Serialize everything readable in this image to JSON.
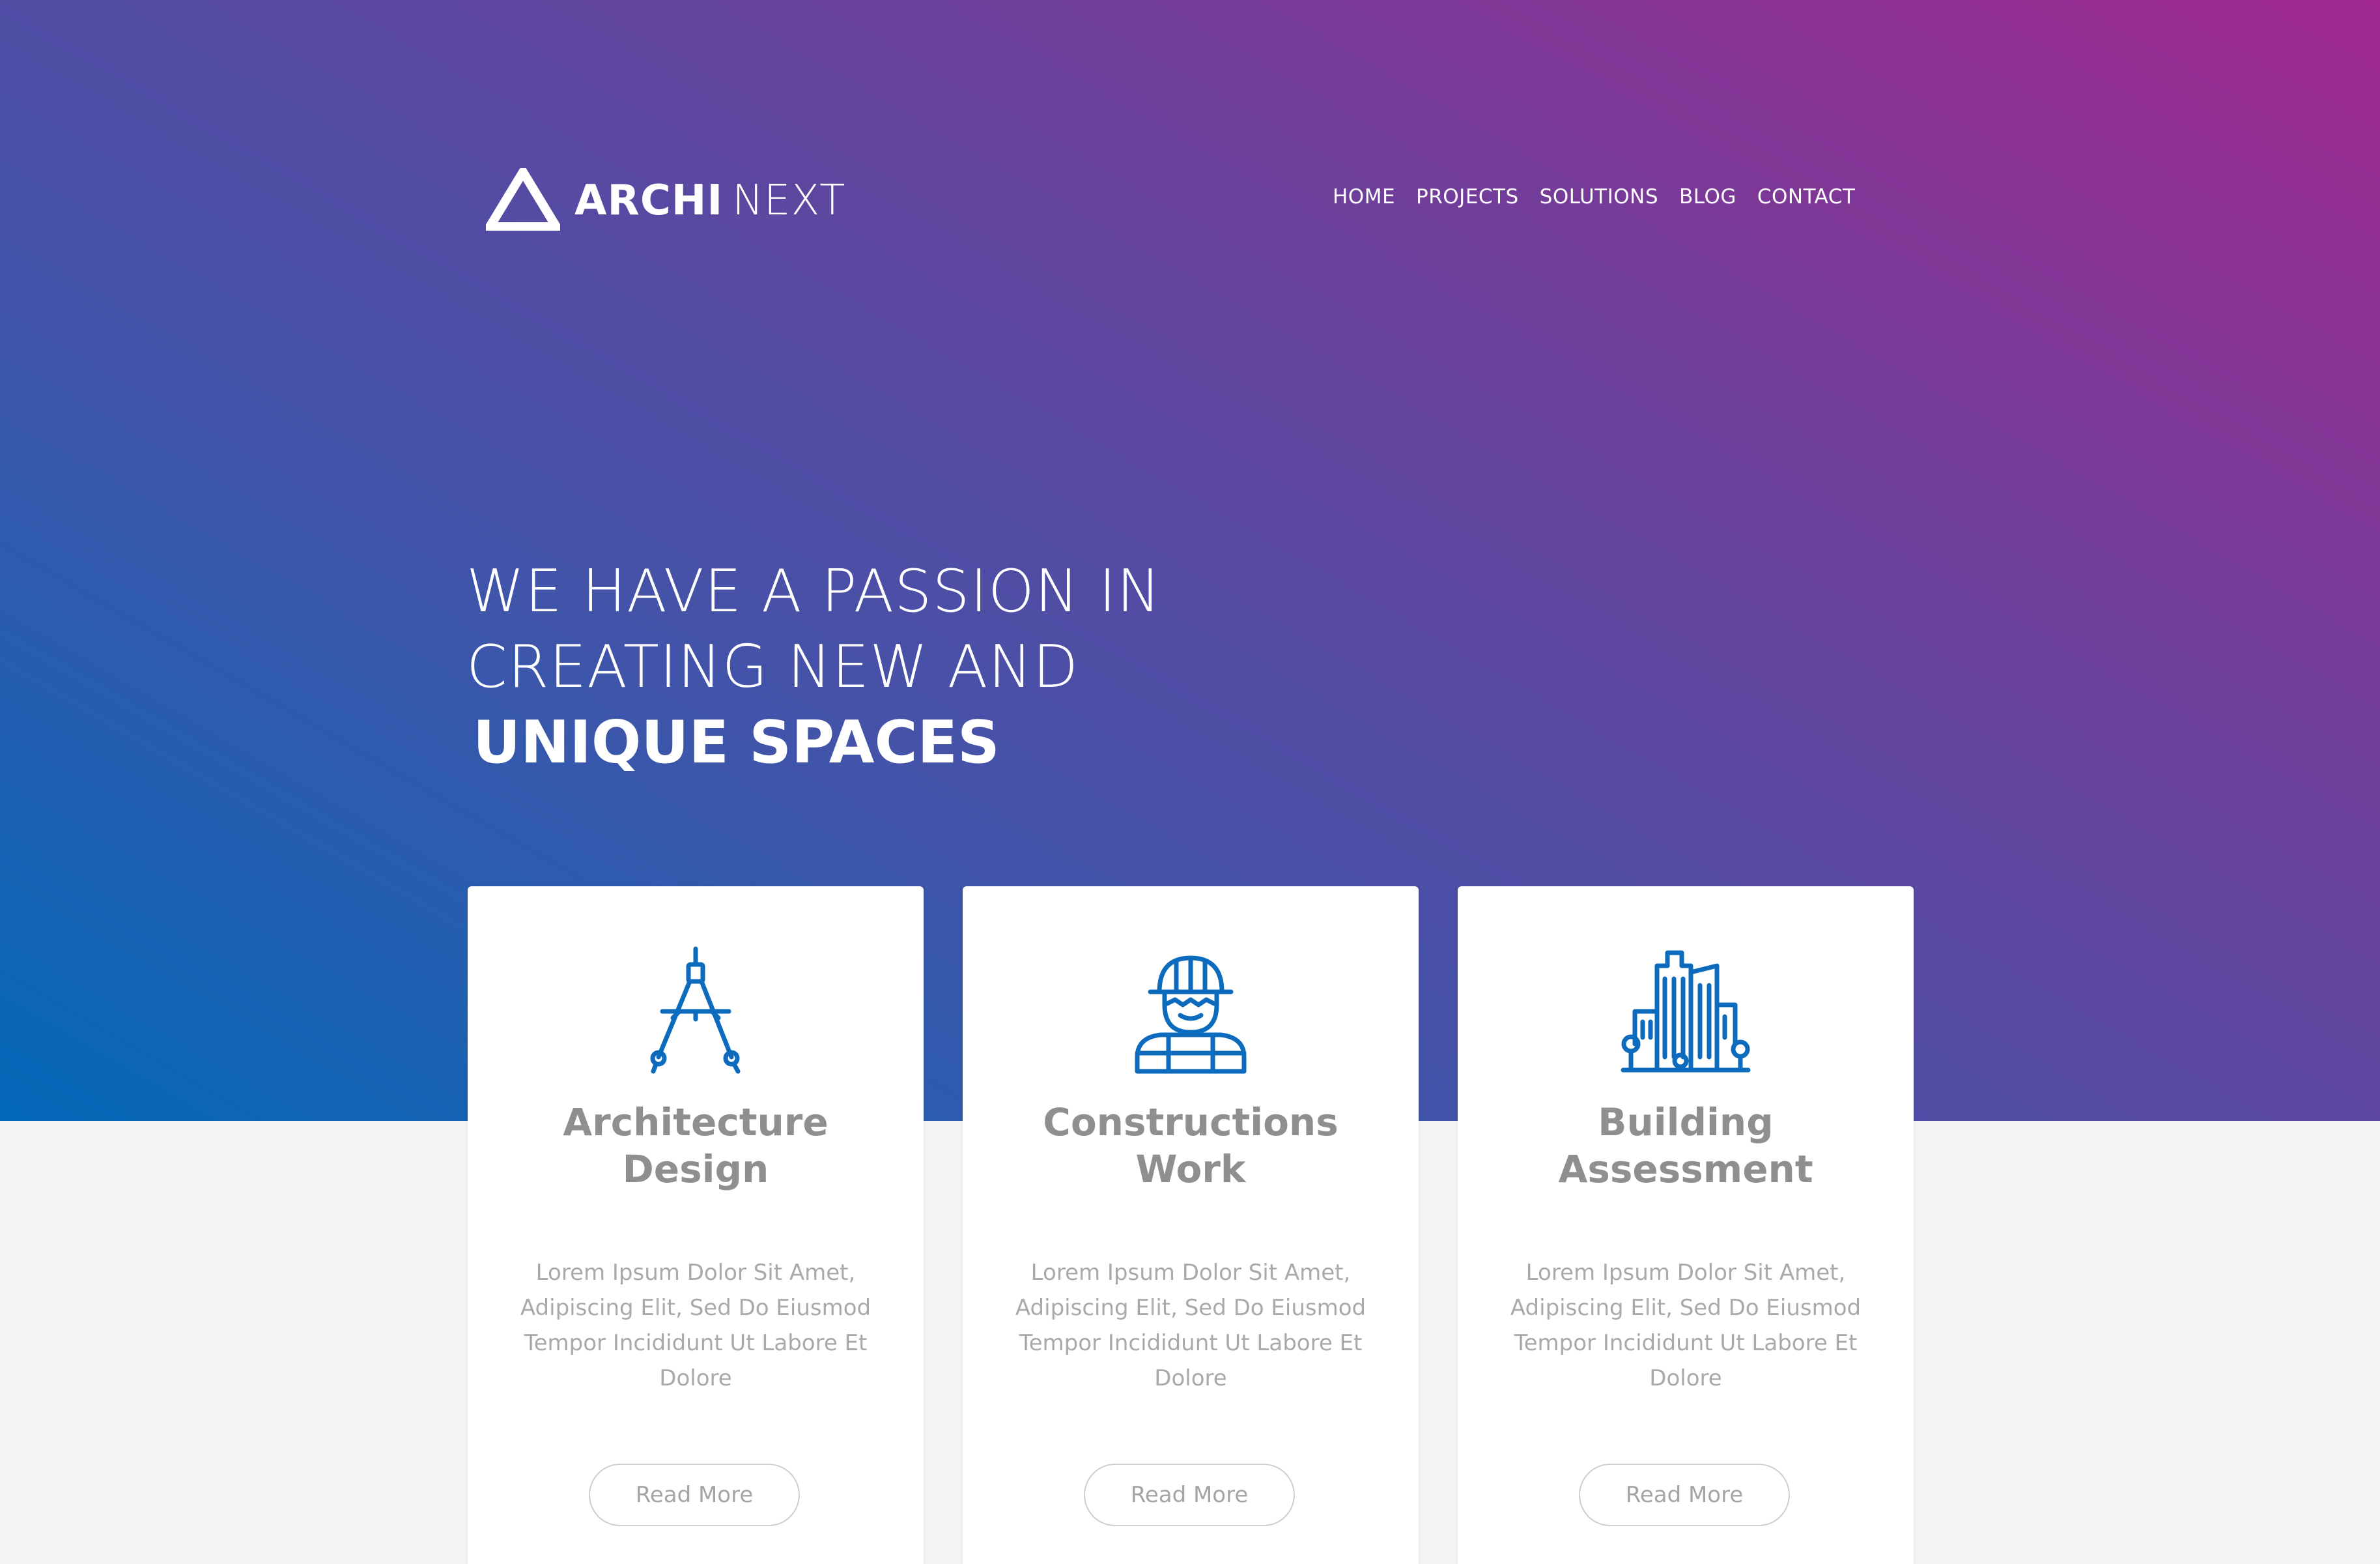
{
  "brand": {
    "name_bold": "ARCHI",
    "name_light": "NEXT",
    "icon": "triangle-logo-icon"
  },
  "nav": {
    "items": [
      {
        "label": "HOME"
      },
      {
        "label": "PROJECTS"
      },
      {
        "label": "SOLUTIONS"
      },
      {
        "label": "BLOG"
      },
      {
        "label": "CONTACT"
      }
    ]
  },
  "hero": {
    "line1": "WE HAVE A PASSION IN",
    "line2": "CREATING NEW AND",
    "line3": "UNIQUE SPACES",
    "gradient_colors": [
      "#0369b9",
      "#6d3f9b",
      "#a0288e"
    ]
  },
  "services": [
    {
      "icon": "drafting-compass-icon",
      "title_line1": "Architecture",
      "title_line2": "Design",
      "description": "Lorem Ipsum Dolor Sit Amet, Adipiscing Elit, Sed Do Eiusmod Tempor Incididunt Ut Labore Et Dolore",
      "button": "Read More"
    },
    {
      "icon": "construction-worker-icon",
      "title_line1": "Constructions",
      "title_line2": "Work",
      "description": "Lorem Ipsum Dolor Sit Amet, Adipiscing Elit, Sed Do Eiusmod Tempor Incididunt Ut Labore Et Dolore",
      "button": "Read More"
    },
    {
      "icon": "city-buildings-icon",
      "title_line1": "Building",
      "title_line2": "Assessment",
      "description": "Lorem Ipsum Dolor Sit Amet, Adipiscing Elit, Sed Do Eiusmod Tempor Incididunt Ut Labore Et Dolore",
      "button": "Read More"
    }
  ],
  "colors": {
    "icon_blue": "#0d6bbd",
    "card_title": "#8f8f8f",
    "page_bg": "#f4f4f4"
  }
}
